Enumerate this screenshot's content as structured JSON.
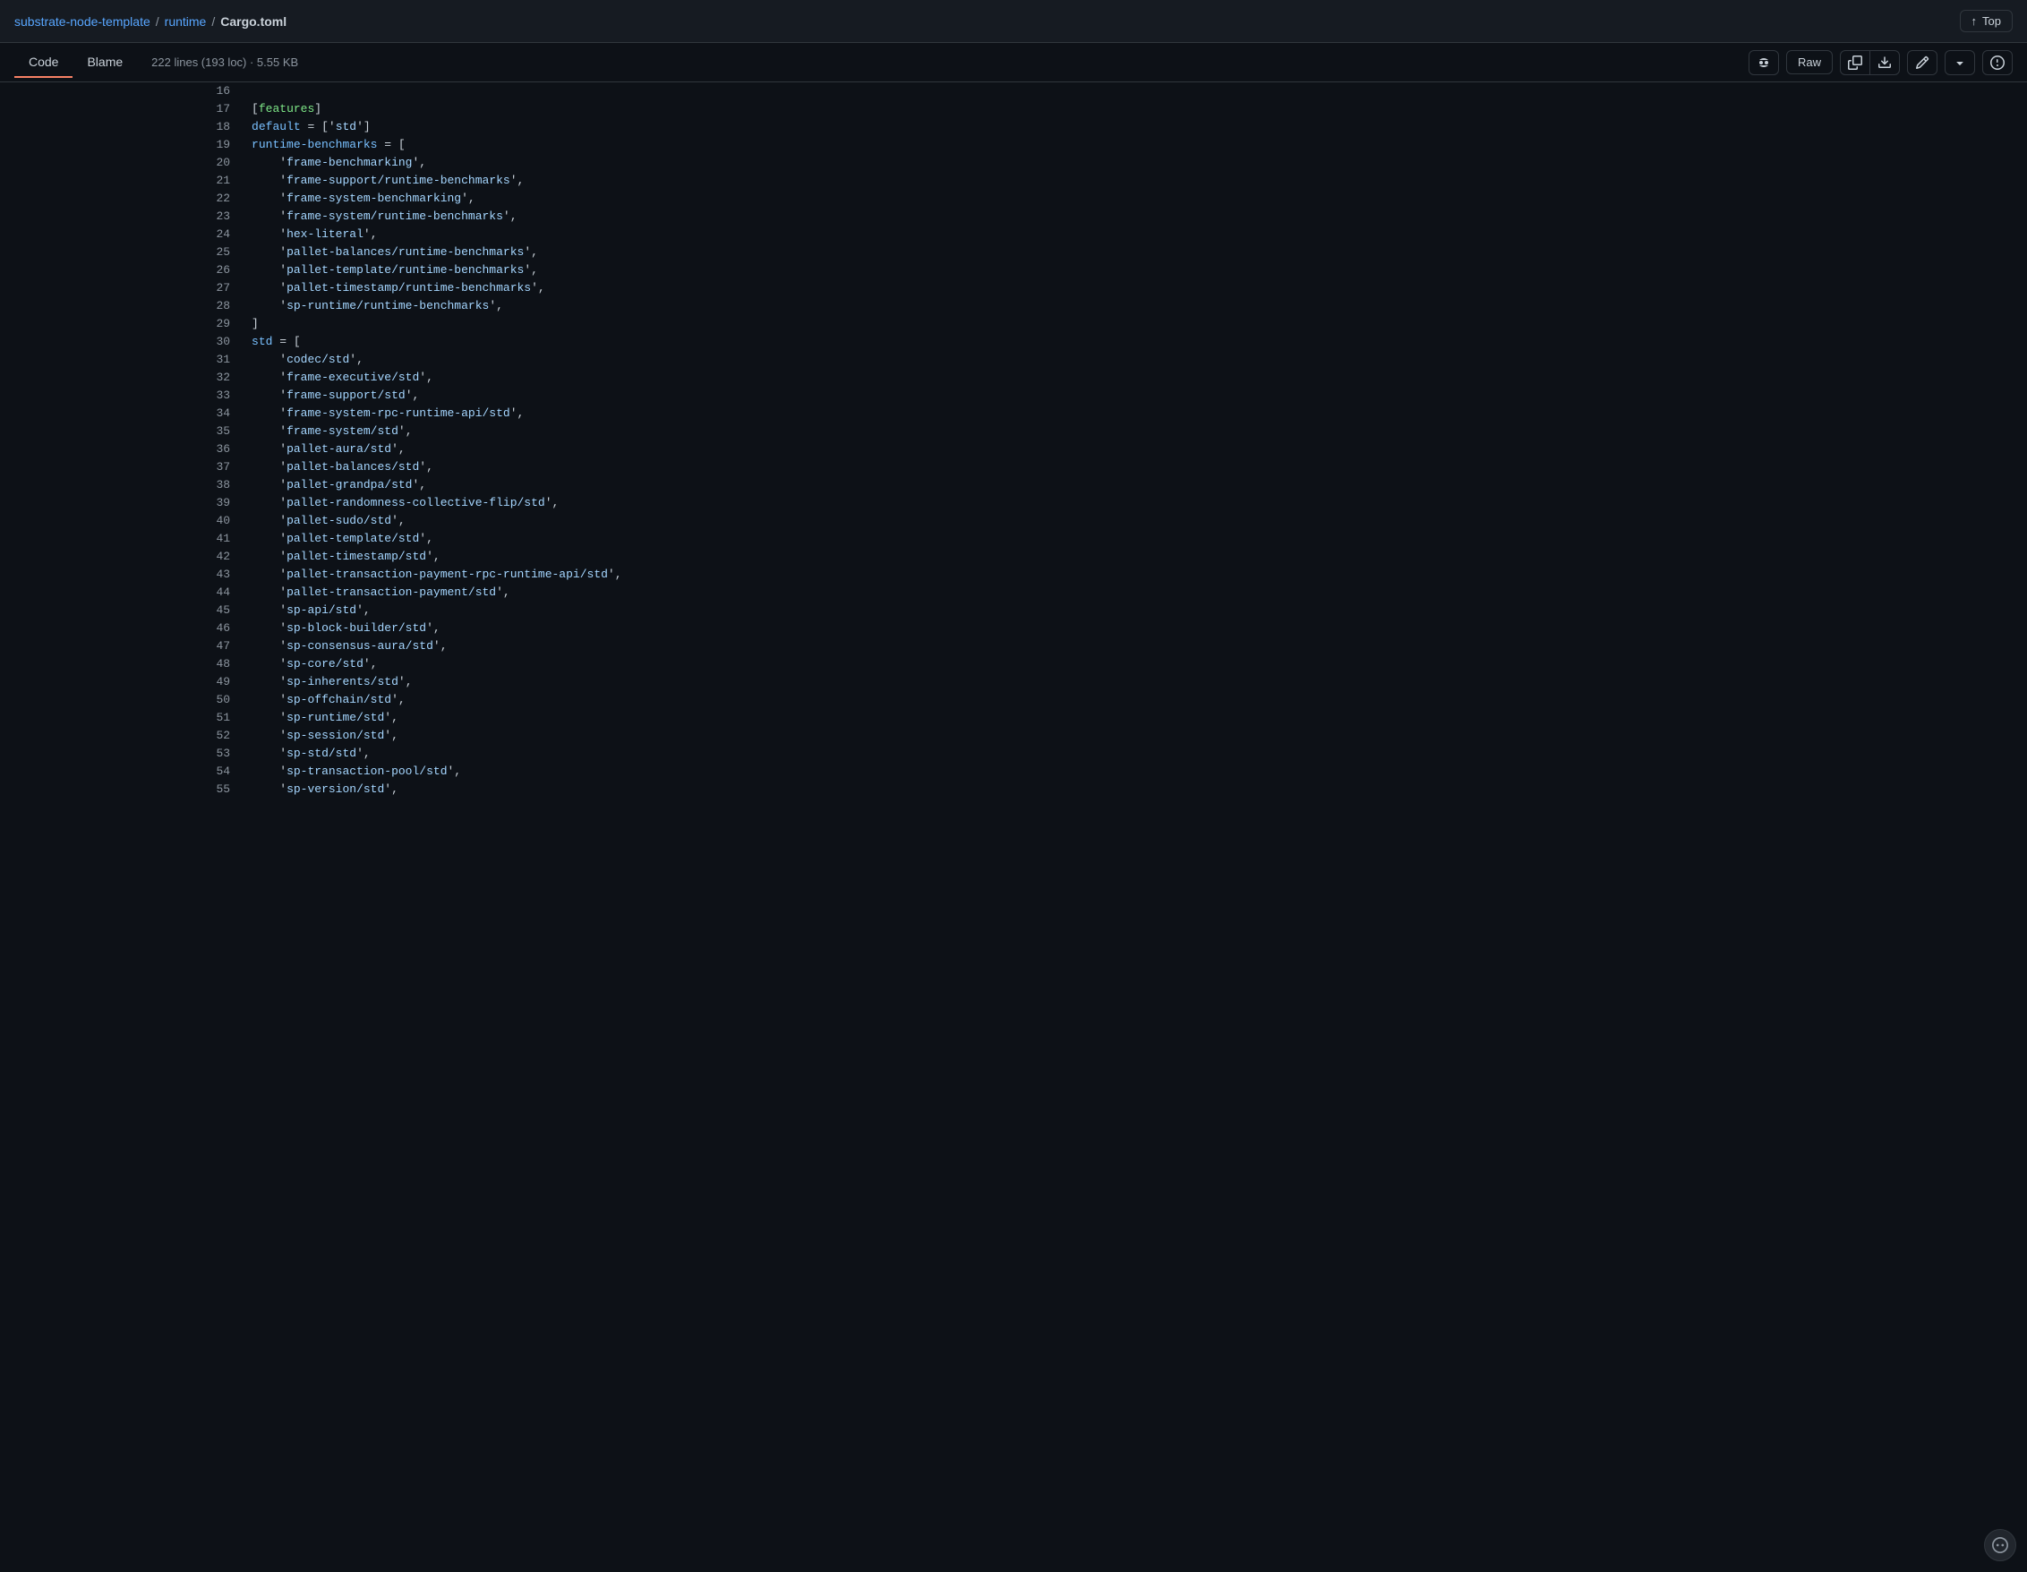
{
  "topbar": {
    "breadcrumb": {
      "repo": "substrate-node-template",
      "separator1": "/",
      "folder": "runtime",
      "separator2": "/",
      "file": "Cargo.toml"
    },
    "top_button": "Top"
  },
  "toolbar": {
    "tab_code": "Code",
    "tab_blame": "Blame",
    "file_info": "222 lines (193 loc) · 5.55 KB",
    "raw_button": "Raw"
  },
  "code": {
    "lines": [
      {
        "num": "16",
        "content": ""
      },
      {
        "num": "17",
        "content": "[features]"
      },
      {
        "num": "18",
        "content": "default = ['std']"
      },
      {
        "num": "19",
        "content": "runtime-benchmarks = ["
      },
      {
        "num": "20",
        "content": "    'frame-benchmarking',"
      },
      {
        "num": "21",
        "content": "    'frame-support/runtime-benchmarks',"
      },
      {
        "num": "22",
        "content": "    'frame-system-benchmarking',"
      },
      {
        "num": "23",
        "content": "    'frame-system/runtime-benchmarks',"
      },
      {
        "num": "24",
        "content": "    'hex-literal',"
      },
      {
        "num": "25",
        "content": "    'pallet-balances/runtime-benchmarks',"
      },
      {
        "num": "26",
        "content": "    'pallet-template/runtime-benchmarks',"
      },
      {
        "num": "27",
        "content": "    'pallet-timestamp/runtime-benchmarks',"
      },
      {
        "num": "28",
        "content": "    'sp-runtime/runtime-benchmarks',"
      },
      {
        "num": "29",
        "content": "]"
      },
      {
        "num": "30",
        "content": "std = ["
      },
      {
        "num": "31",
        "content": "    'codec/std',"
      },
      {
        "num": "32",
        "content": "    'frame-executive/std',"
      },
      {
        "num": "33",
        "content": "    'frame-support/std',"
      },
      {
        "num": "34",
        "content": "    'frame-system-rpc-runtime-api/std',"
      },
      {
        "num": "35",
        "content": "    'frame-system/std',"
      },
      {
        "num": "36",
        "content": "    'pallet-aura/std',"
      },
      {
        "num": "37",
        "content": "    'pallet-balances/std',"
      },
      {
        "num": "38",
        "content": "    'pallet-grandpa/std',"
      },
      {
        "num": "39",
        "content": "    'pallet-randomness-collective-flip/std',"
      },
      {
        "num": "40",
        "content": "    'pallet-sudo/std',"
      },
      {
        "num": "41",
        "content": "    'pallet-template/std',"
      },
      {
        "num": "42",
        "content": "    'pallet-timestamp/std',"
      },
      {
        "num": "43",
        "content": "    'pallet-transaction-payment-rpc-runtime-api/std',"
      },
      {
        "num": "44",
        "content": "    'pallet-transaction-payment/std',"
      },
      {
        "num": "45",
        "content": "    'sp-api/std',"
      },
      {
        "num": "46",
        "content": "    'sp-block-builder/std',"
      },
      {
        "num": "47",
        "content": "    'sp-consensus-aura/std',"
      },
      {
        "num": "48",
        "content": "    'sp-core/std',"
      },
      {
        "num": "49",
        "content": "    'sp-inherents/std',"
      },
      {
        "num": "50",
        "content": "    'sp-offchain/std',"
      },
      {
        "num": "51",
        "content": "    'sp-runtime/std',"
      },
      {
        "num": "52",
        "content": "    'sp-session/std',"
      },
      {
        "num": "53",
        "content": "    'sp-std/std',"
      },
      {
        "num": "54",
        "content": "    'sp-transaction-pool/std',"
      },
      {
        "num": "55",
        "content": "    'sp-version/std',"
      }
    ]
  }
}
